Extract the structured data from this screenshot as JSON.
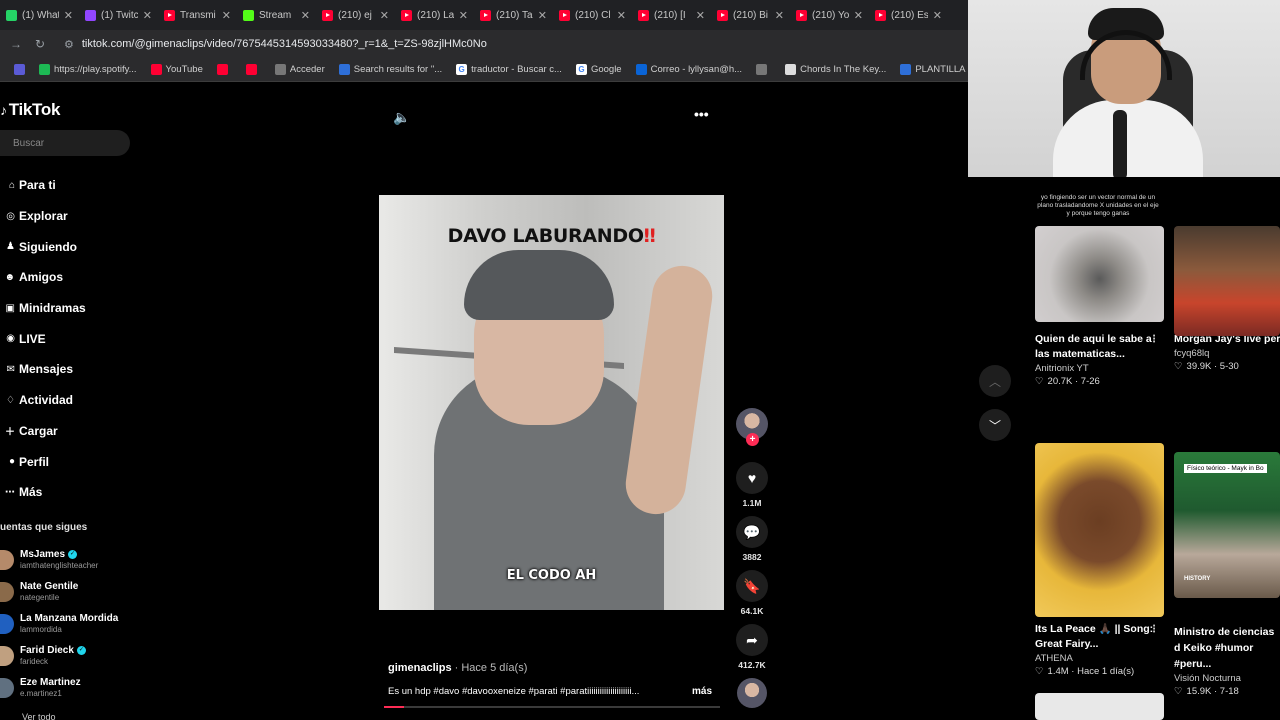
{
  "browser": {
    "tabs": [
      {
        "label": "(1) What",
        "icon": "whatsapp-icon",
        "color": "#25d366"
      },
      {
        "label": "(1) Twitc",
        "icon": "twitch-icon",
        "color": "#9146ff"
      },
      {
        "label": "Transmi",
        "icon": "youtube-icon",
        "color": "#ff0033"
      },
      {
        "label": "Stream",
        "icon": "kick-icon",
        "color": "#53fc18"
      },
      {
        "label": "(210) ej",
        "icon": "youtube-icon",
        "color": "#ff0033"
      },
      {
        "label": "(210) La",
        "icon": "youtube-icon",
        "color": "#ff0033"
      },
      {
        "label": "(210) Ta",
        "icon": "youtube-icon",
        "color": "#ff0033"
      },
      {
        "label": "(210) Cl",
        "icon": "youtube-icon",
        "color": "#ff0033"
      },
      {
        "label": "(210) [I",
        "icon": "youtube-icon",
        "color": "#ff0033"
      },
      {
        "label": "(210) Bi",
        "icon": "youtube-icon",
        "color": "#ff0033"
      },
      {
        "label": "(210) Yo",
        "icon": "youtube-icon",
        "color": "#ff0033"
      },
      {
        "label": "(210) Es",
        "icon": "youtube-icon",
        "color": "#ff0033"
      }
    ],
    "url": "tiktok.com/@gimenaclips/video/7675445314593033480?_r=1&_t=ZS-98zjlHMc0No",
    "bookmarks": [
      {
        "label": "https://play.spotify...",
        "color": "#1db954",
        "glyph": ""
      },
      {
        "label": "YouTube",
        "color": "#ff0033",
        "glyph": ""
      },
      {
        "label": "",
        "color": "#ff0033",
        "glyph": ""
      },
      {
        "label": "",
        "color": "#ff0033",
        "glyph": ""
      },
      {
        "label": "Acceder",
        "color": "#777",
        "glyph": ""
      },
      {
        "label": "Search results for \"...",
        "color": "#2e6fd8",
        "glyph": ""
      },
      {
        "label": "traductor - Buscar c...",
        "color": "#fff",
        "glyph": "G"
      },
      {
        "label": "Google",
        "color": "#fff",
        "glyph": "G"
      },
      {
        "label": "Correo - lyllysan@h...",
        "color": "#0a64d6",
        "glyph": ""
      },
      {
        "label": "",
        "color": "#777",
        "glyph": ""
      },
      {
        "label": "Chords In The Key...",
        "color": "#ddd",
        "glyph": ""
      },
      {
        "label": "PLANTILLA PARA C...",
        "color": "#2e6fd8",
        "glyph": ""
      }
    ]
  },
  "sidebar": {
    "logo": "TikTok",
    "search_placeholder": "Buscar",
    "menu": [
      {
        "label": "Para ti",
        "icon": "home-icon"
      },
      {
        "label": "Explorar",
        "icon": "compass-icon"
      },
      {
        "label": "Siguiendo",
        "icon": "following-icon"
      },
      {
        "label": "Amigos",
        "icon": "friends-icon"
      },
      {
        "label": "Minidramas",
        "icon": "minidramas-icon"
      },
      {
        "label": "LIVE",
        "icon": "live-icon"
      },
      {
        "label": "Mensajes",
        "icon": "messages-icon"
      },
      {
        "label": "Actividad",
        "icon": "activity-icon"
      },
      {
        "label": "Cargar",
        "icon": "upload-icon"
      },
      {
        "label": "Perfil",
        "icon": "profile-icon"
      },
      {
        "label": "Más",
        "icon": "more-icon"
      }
    ],
    "following_title": "uentas que sigues",
    "following": [
      {
        "name": "MsJames",
        "handle": "iamthatenglishteacher",
        "verified": true
      },
      {
        "name": "Nate Gentile",
        "handle": "nategentile",
        "verified": false
      },
      {
        "name": "La Manzana Mordida",
        "handle": "lammordida",
        "verified": false
      },
      {
        "name": "Farid Dieck",
        "handle": "farideck",
        "verified": true
      },
      {
        "name": "Eze Martinez",
        "handle": "e.martinez1",
        "verified": false
      }
    ],
    "see_all": "Ver todo"
  },
  "video": {
    "caption_top": "DAVO LABURANDO",
    "caption_top_mark": "‼",
    "caption_bottom": "EL CODO AH",
    "progress": 0.06
  },
  "actions": {
    "likes": "1.1M",
    "comments": "3882",
    "saves": "64.1K",
    "shares": "412.7K"
  },
  "post": {
    "username": "gimenaclips",
    "time": " · Hace 5 día(s)",
    "description": "Es un hdp #davo #davooxeneize #parati #paratiiiiiiiiiiiiiiiiiiiii...",
    "more": "más"
  },
  "recommendations": {
    "top_text": "yo fingiendo ser un vector normal de un plano trasladandome X unidades en el eje y porque tengo ganas",
    "cards": [
      {
        "title": "Quien de aqui le sabe a las matematicas...",
        "author": "Anitrionix YT",
        "stats": "20.7K · 7-26"
      },
      {
        "title": "Morgan Jay's live performance.#fyp...",
        "author": "fcyq68lq",
        "stats": "39.9K · 5-30"
      },
      {
        "title": "Its La Peace 🙏🏿 || Song: Great Fairy...",
        "author": "ATHENA",
        "stats": "1.4M · Hace 1 día(s)"
      },
      {
        "title": "Ministro de ciencias d Keiko #humor #peru...",
        "author": "Visión Nocturna",
        "stats": "15.9K · 7-18"
      }
    ],
    "tv_tag": "Físico teórico - Mayk in Bo",
    "tv_brand": "HISTORY"
  }
}
